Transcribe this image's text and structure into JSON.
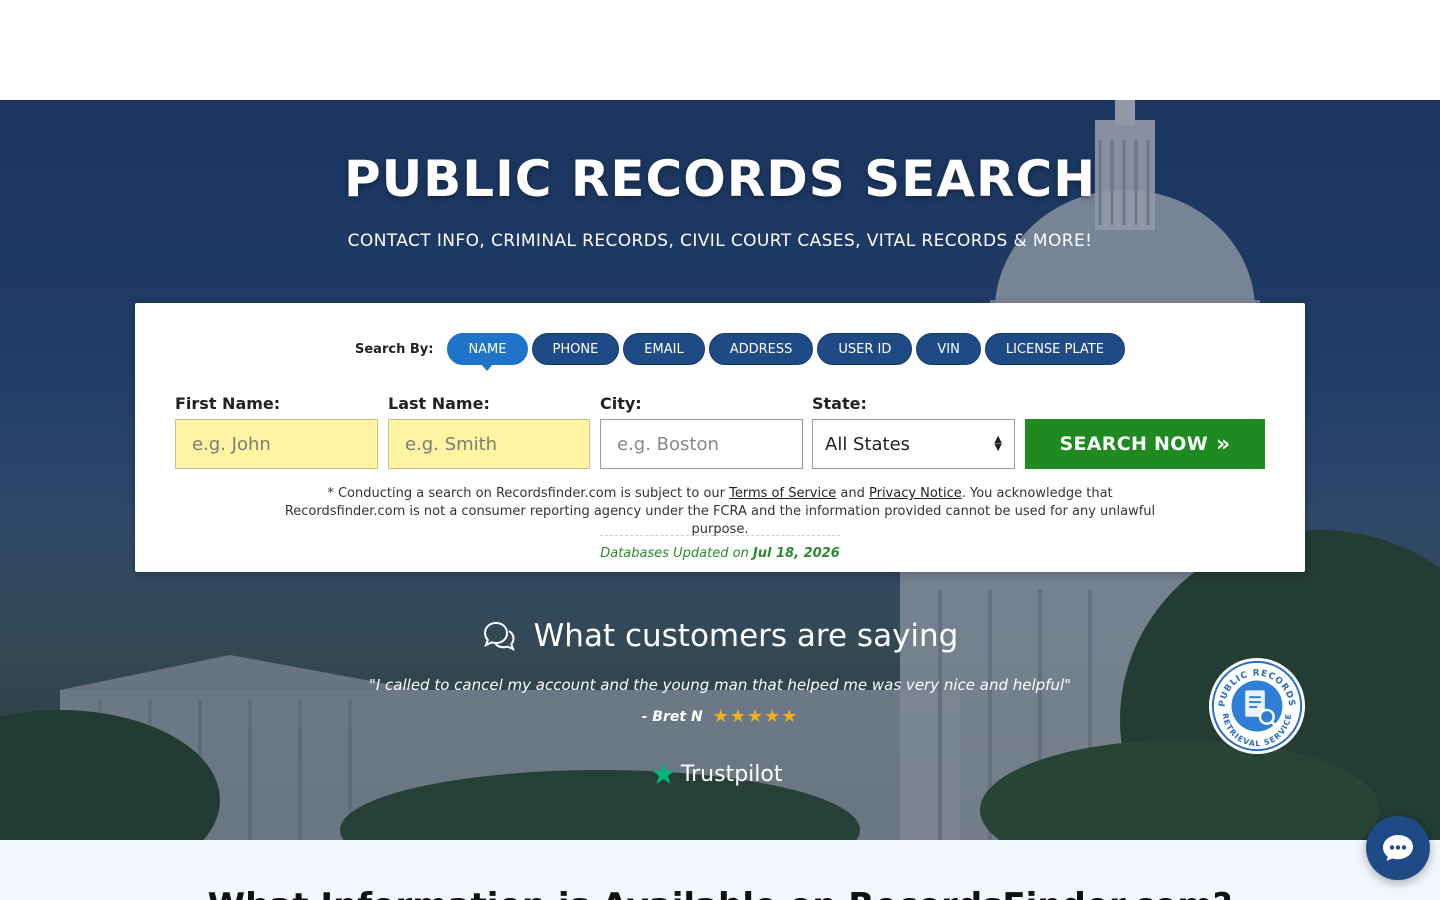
{
  "hero": {
    "title": "PUBLIC RECORDS SEARCH",
    "subtitle": "CONTACT INFO, CRIMINAL RECORDS, CIVIL COURT CASES, VITAL RECORDS & MORE!"
  },
  "search": {
    "search_by_label": "Search By:",
    "tabs": [
      {
        "label": "NAME",
        "active": true
      },
      {
        "label": "PHONE",
        "active": false
      },
      {
        "label": "EMAIL",
        "active": false
      },
      {
        "label": "ADDRESS",
        "active": false
      },
      {
        "label": "USER ID",
        "active": false
      },
      {
        "label": "VIN",
        "active": false
      },
      {
        "label": "LICENSE PLATE",
        "active": false
      }
    ],
    "first_name": {
      "label": "First Name:",
      "placeholder": "e.g. John"
    },
    "last_name": {
      "label": "Last Name:",
      "placeholder": "e.g. Smith"
    },
    "city": {
      "label": "City:",
      "placeholder": "e.g. Boston"
    },
    "state": {
      "label": "State:",
      "selected": "All States"
    },
    "submit_label": "SEARCH NOW",
    "disclaimer_pre": "* Conducting a search on Recordsfinder.com is subject to our ",
    "terms_link": "Terms of Service",
    "and_text": " and ",
    "privacy_link": "Privacy Notice",
    "disclaimer_post": ". You acknowledge that Recordsfinder.com is not a consumer reporting agency under the FCRA and the information provided cannot be used for any unlawful purpose.",
    "db_updated_label": "Databases Updated on ",
    "db_updated_date": "Jul 18, 2026"
  },
  "testimonials": {
    "heading": "What customers are saying",
    "quote": "\"I called to cancel my account and the young man that helped me was very nice and helpful\"",
    "author": "- Bret N",
    "rating": 5,
    "trustpilot_label": "Trustpilot"
  },
  "badge": {
    "text": "PUBLIC RECORDS RETRIEVAL SERVICE"
  },
  "info": {
    "title": "What Information is Available on RecordsFinder.com?"
  },
  "colors": {
    "primary_blue": "#1e4a85",
    "active_tab": "#1f74c9",
    "search_green": "#1f8a1f",
    "input_yellow": "#fff4a3",
    "star_gold": "#f2b01e",
    "trustpilot_green": "#00b67a"
  },
  "icons": {
    "testimonials": "chat-bubbles-icon",
    "chevron": "double-chevron-right-icon",
    "chat_fab": "chat-dots-icon",
    "badge": "document-search-icon"
  }
}
